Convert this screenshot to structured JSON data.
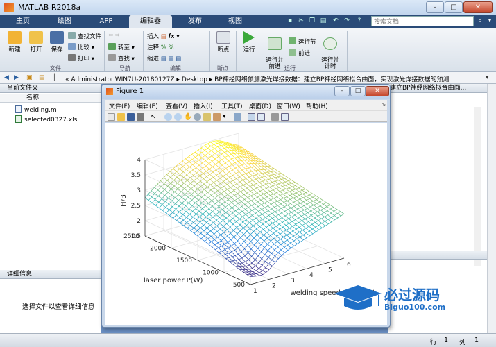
{
  "window": {
    "title": "MATLAB R2018a"
  },
  "tabs": [
    {
      "label": "主页"
    },
    {
      "label": "绘图"
    },
    {
      "label": "APP"
    },
    {
      "label": "编辑器"
    },
    {
      "label": "发布"
    },
    {
      "label": "视图"
    }
  ],
  "search": {
    "placeholder": "搜索文档"
  },
  "ribbon": {
    "file": {
      "new": "新建",
      "open": "打开",
      "save": "保存",
      "find_files": "查找文件",
      "compare": "比较",
      "print": "打印",
      "group": "文件"
    },
    "navigate": {
      "goto": "转至",
      "find": "查找",
      "group": "导航"
    },
    "edit": {
      "insert": "插入",
      "comment": "注释",
      "indent": "缩进",
      "group": "编辑"
    },
    "breakpoints": {
      "label": "断点",
      "group": "断点"
    },
    "run": {
      "run": "运行",
      "run_advance": "运行并\n前进",
      "run_section": "运行节",
      "advance": "前进",
      "run_time": "运行并\n计时",
      "group": "运行"
    }
  },
  "path": {
    "text": "« Administrator.WIN7U-20180127Z  ▸  Desktop  ▸  BP神经网络预测激光焊接数据：建立BP神经网络拟合曲面，实现激光焊接数据的预测"
  },
  "left_panel": {
    "header": "当前文件夹",
    "column": "名称",
    "files": [
      {
        "name": "welding.m"
      },
      {
        "name": "selected0327.xls"
      }
    ],
    "detail_header": "详细信息",
    "detail_text": "选择文件以查看详细信息"
  },
  "right_panel": {
    "crumb": "建立BP神经网络拟合曲面..."
  },
  "status": {
    "row_label": "行",
    "row": "1",
    "col_label": "列",
    "col": "1"
  },
  "figure": {
    "title": "Figure 1",
    "menu": [
      "文件(F)",
      "编辑(E)",
      "查看(V)",
      "插入(I)",
      "工具(T)",
      "桌面(D)",
      "窗口(W)",
      "帮助(H)"
    ]
  },
  "chart_data": {
    "type": "surface",
    "xlabel": "welding speed V(m/min)",
    "ylabel": "laser power P(W)",
    "zlabel": "H/B",
    "x_ticks": [
      1,
      2,
      3,
      4,
      5,
      6
    ],
    "y_ticks": [
      500,
      1000,
      1500,
      2000,
      2500
    ],
    "z_ticks": [
      1.5,
      2,
      2.5,
      3,
      3.5,
      4
    ],
    "xlim": [
      1,
      6
    ],
    "ylim": [
      500,
      2500
    ],
    "zlim": [
      1.5,
      4
    ],
    "colormap": "parula"
  },
  "watermark": {
    "brand": "必过源码",
    "url": "Biguo100.com"
  }
}
